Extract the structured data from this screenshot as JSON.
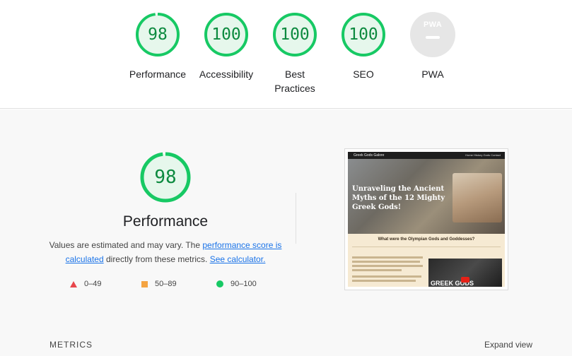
{
  "categories": [
    {
      "label": "Performance",
      "score": "98",
      "fraction": 0.98
    },
    {
      "label": "Accessibility",
      "score": "100",
      "fraction": 1.0
    },
    {
      "label": "Best Practices",
      "score": "100",
      "fraction": 1.0
    },
    {
      "label": "SEO",
      "score": "100",
      "fraction": 1.0
    },
    {
      "label": "PWA",
      "badge": "PWA"
    }
  ],
  "performance": {
    "score": "98",
    "fraction": 0.98,
    "title": "Performance",
    "desc_part1": "Values are estimated and may vary. The ",
    "desc_link1": "performance score is calculated",
    "desc_part2": " directly from these metrics. ",
    "desc_link2": "See calculator."
  },
  "legend": [
    {
      "shape": "triangle",
      "label": "0–49",
      "color": "#e8474c"
    },
    {
      "shape": "square",
      "label": "50–89",
      "color": "#f4a442"
    },
    {
      "shape": "circle",
      "label": "90–100",
      "color": "#17c964"
    }
  ],
  "screenshot": {
    "brand": "Greek Gods Galore",
    "nav_links": "Home  History  Gods  Contact",
    "hero_title": "Unraveling the Ancient Myths of the 12 Mighty Greek Gods!",
    "section_title": "What were the Olympian Gods and Goddesses?",
    "video_text": "GREEK GODS"
  },
  "footer": {
    "metrics_label": "METRICS",
    "expand_label": "Expand view"
  },
  "colors": {
    "pass": "#0c8a3f",
    "pass_ring": "#17c964",
    "pass_fill": "#e6f7ec"
  }
}
